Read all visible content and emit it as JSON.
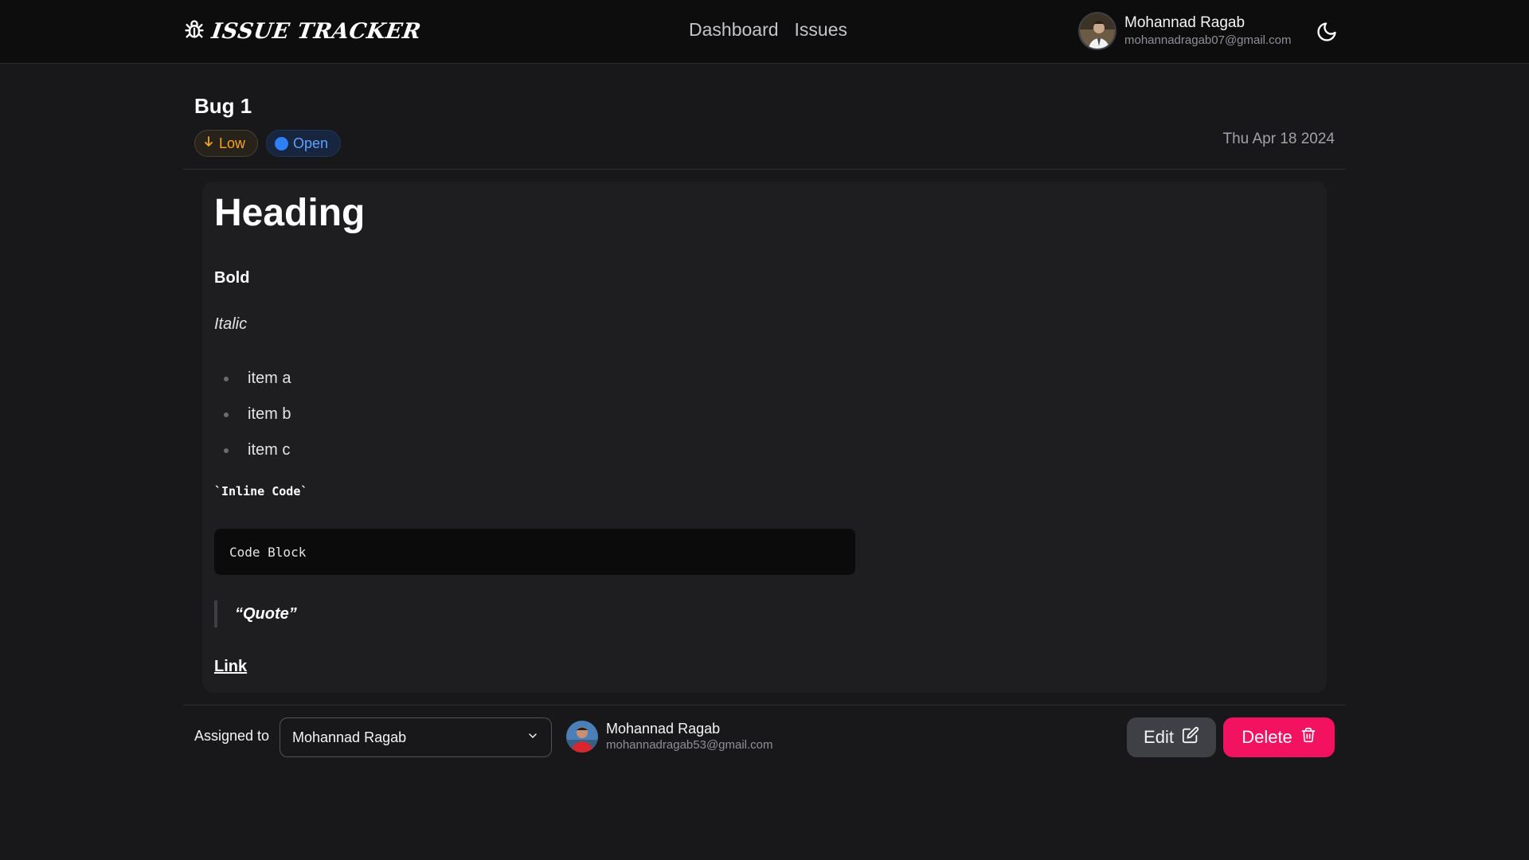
{
  "navbar": {
    "logo_text": "Issue Tracker",
    "links": [
      "Dashboard",
      "Issues"
    ],
    "user": {
      "name": "Mohannad Ragab",
      "email": "mohannadragab07@gmail.com"
    },
    "theme_icon": "moon-icon"
  },
  "issue": {
    "title": "Bug 1",
    "priority": "Low",
    "priority_icon": "arrow-down-icon",
    "status": "Open",
    "date": "Thu Apr 18 2024"
  },
  "content": {
    "heading": "Heading",
    "bold": "Bold",
    "italic": "Italic",
    "list": [
      "item a",
      "item b",
      "item c"
    ],
    "inline_code": "`Inline Code`",
    "code_block": "Code Block",
    "quote": "“Quote”",
    "link": "Link"
  },
  "footer": {
    "assigned_label": "Assigned to",
    "assigned_value": "Mohannad Ragab",
    "assignee": {
      "name": "Mohannad Ragab",
      "email": "mohannadragab53@gmail.com"
    },
    "edit_label": "Edit",
    "delete_label": "Delete"
  },
  "colors": {
    "background": "#18181b",
    "navbar": "#0d0d0e",
    "priority_low": "#f5a524",
    "status_open": "#2f7ff5",
    "danger": "#f31260"
  }
}
